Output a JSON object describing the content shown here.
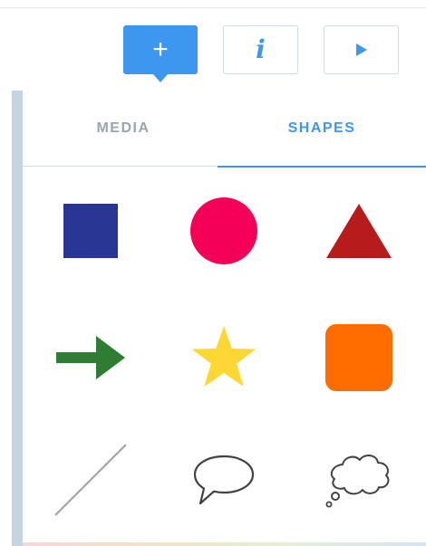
{
  "toolbar": {
    "add_glyph": "+",
    "info_glyph": "i",
    "accent_color": "#3d97ee"
  },
  "tabs": [
    {
      "label": "MEDIA",
      "active": false
    },
    {
      "label": "SHAPES",
      "active": true
    }
  ],
  "shapes": [
    {
      "name": "square",
      "color": "#283593"
    },
    {
      "name": "circle",
      "color": "#f50057"
    },
    {
      "name": "triangle",
      "color": "#b71c1c"
    },
    {
      "name": "arrow",
      "color": "#2e7d32"
    },
    {
      "name": "star",
      "color": "#fdd835"
    },
    {
      "name": "rounded-square",
      "color": "#ff6d00"
    },
    {
      "name": "line",
      "color": "#a4a4a4"
    },
    {
      "name": "speech-bubble",
      "color": "#424242"
    },
    {
      "name": "thought-bubble",
      "color": "#424242"
    }
  ]
}
